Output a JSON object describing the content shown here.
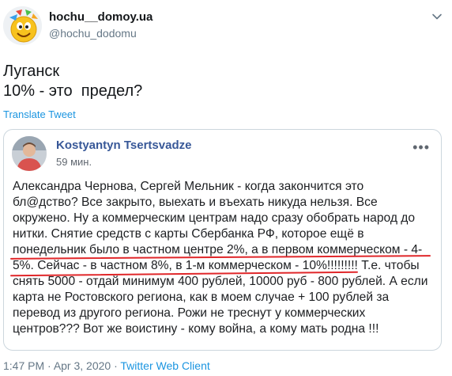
{
  "author": {
    "name": "hochu__domoy.ua",
    "handle": "@hochu_dodomu"
  },
  "tweet": {
    "text_line1": "Луганск",
    "text_line2": "10% - это  предел?",
    "translate_label": "Translate Tweet"
  },
  "embedded_post": {
    "author_name": "Kostyantyn Tsertsvadze",
    "time": "59 мин.",
    "more_icon": "more-horizontal-icon",
    "lines": [
      "Александра Чернова, Сергей Мельник - когда закончится это",
      "бл@дство? Все закрыто, выехать и въехать никуда нельзя. Все",
      "окружено. Ну а коммерческим центрам надо сразу обобрать народ до",
      "нитки. Снятие средств с карты Сбербанка РФ, которое ещё в",
      "понедельник было в частном центре 2%, а в первом коммерческом - 4-",
      "5%. Сейчас - в частном 8%, в 1-м коммерческом - 10%!!!!!!!!! Т.е. чтобы",
      "снять 5000 - отдай минимум 400 рублей, 10000 руб - 800 рублей. А если",
      "карта не Ростовского региона, как в моем случае + 100 рублей за",
      "перевод из другого региона. Рожи не треснут у коммерческих",
      "центров??? Вот же воистину - кому война, а кому мать родна !!!"
    ],
    "underline_color": "#e0272a"
  },
  "meta": {
    "time": "1:47 PM",
    "sep1": " · ",
    "date": "Apr 3, 2020",
    "sep2": " · ",
    "client": "Twitter Web Client"
  },
  "colors": {
    "link": "#1b95e0",
    "fb_name": "#385898",
    "muted": "#657786"
  }
}
